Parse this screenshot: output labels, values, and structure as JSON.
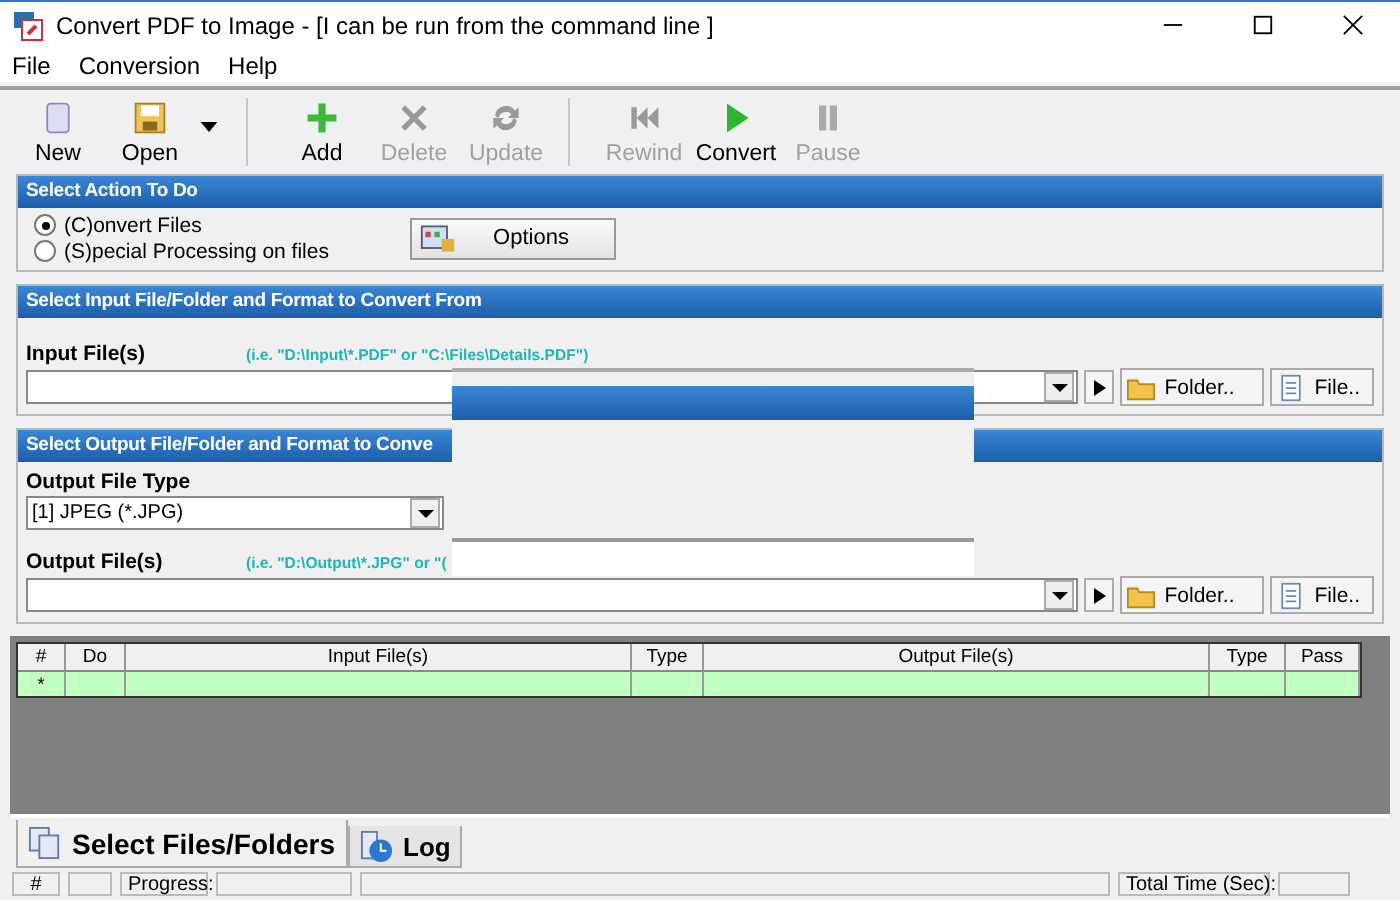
{
  "window": {
    "title": "Convert PDF to Image - [I can be run from the command line ]"
  },
  "menu": [
    "File",
    "Conversion",
    "Help"
  ],
  "toolbar": [
    {
      "label": "New",
      "disabled": false,
      "dropdown": false
    },
    {
      "label": "Open",
      "disabled": false,
      "dropdown": true
    },
    {
      "label": "Add",
      "disabled": false,
      "dropdown": false
    },
    {
      "label": "Delete",
      "disabled": true,
      "dropdown": false
    },
    {
      "label": "Update",
      "disabled": true,
      "dropdown": false
    },
    {
      "label": "Rewind",
      "disabled": true,
      "dropdown": false
    },
    {
      "label": "Convert",
      "disabled": false,
      "dropdown": false
    },
    {
      "label": "Pause",
      "disabled": true,
      "dropdown": false
    }
  ],
  "action_section": {
    "title": "Select Action To Do",
    "radios": [
      {
        "label": "(C)onvert Files",
        "selected": true
      },
      {
        "label": "(S)pecial Processing on files",
        "selected": false
      }
    ],
    "options_button": "Options"
  },
  "input_section": {
    "title": "Select Input File/Folder and Format to Convert From",
    "label": "Input File(s)",
    "hint": "(i.e. \"D:\\Input\\*.PDF\"  or \"C:\\Files\\Details.PDF\")",
    "buttons": [
      "Folder..",
      "File.."
    ]
  },
  "output_section": {
    "title": "Select Output File/Folder and Format to Conve",
    "type_label": "Output File Type",
    "type_value": "[1] JPEG (*.JPG)",
    "label": "Output File(s)",
    "hint": "(i.e. \"D:\\Output\\*.JPG\"  or \"(",
    "buttons": [
      "Folder..",
      "File.."
    ]
  },
  "grid": {
    "columns": [
      "#",
      "Do",
      "Input File(s)",
      "Type",
      "Output File(s)",
      "Type",
      "Pass"
    ],
    "new_row_marker": "*"
  },
  "tabs": [
    {
      "label": "Select Files/Folders",
      "selected": true
    },
    {
      "label": "Log",
      "selected": false
    }
  ],
  "status_bar": {
    "count_label": "#",
    "progress_label": "Progress:",
    "time_label": "Total Time (Sec):"
  }
}
